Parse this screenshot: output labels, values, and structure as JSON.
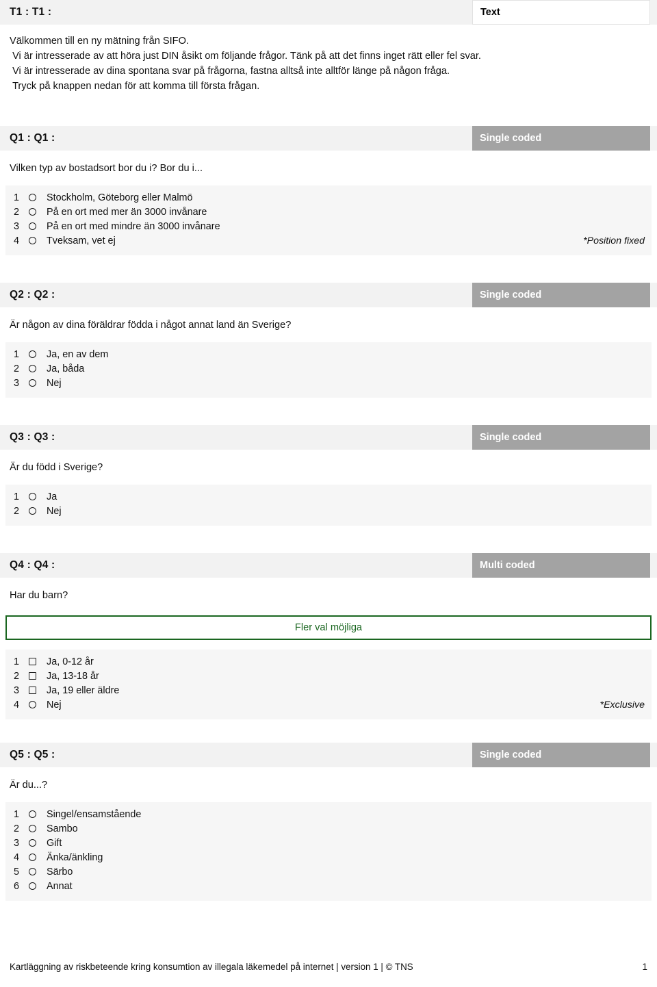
{
  "intro_section": {
    "title": "T1 : T1 :",
    "type_badge": "Text",
    "body_lines": [
      "Välkommen till en ny mätning från SIFO.",
      " Vi är intresserade av att höra just DIN åsikt om följande frågor. Tänk på att det finns inget rätt eller fel svar.",
      " Vi är intresserade av dina spontana svar på frågorna, fastna alltså inte alltför länge på någon fråga.",
      " Tryck på knappen nedan för att komma till första frågan."
    ]
  },
  "questions": [
    {
      "title": "Q1 : Q1 :",
      "type_badge": "Single coded",
      "text": "Vilken typ av bostadsort bor du i? Bor du i...",
      "note": "*Position fixed",
      "options": [
        {
          "num": "1",
          "mark": "radio-icon",
          "label": "Stockholm, Göteborg eller Malmö"
        },
        {
          "num": "2",
          "mark": "radio-icon",
          "label": "På en ort med mer än 3000 invånare"
        },
        {
          "num": "3",
          "mark": "radio-icon",
          "label": "På en ort med mindre än 3000 invånare"
        },
        {
          "num": "4",
          "mark": "radio-icon",
          "label": "Tveksam, vet ej"
        }
      ]
    },
    {
      "title": "Q2 : Q2 :",
      "type_badge": "Single coded",
      "text": "Är någon av dina föräldrar födda i något annat land än Sverige?",
      "note": "",
      "options": [
        {
          "num": "1",
          "mark": "radio-icon",
          "label": "Ja, en av dem"
        },
        {
          "num": "2",
          "mark": "radio-icon",
          "label": "Ja, båda"
        },
        {
          "num": "3",
          "mark": "radio-icon",
          "label": "Nej"
        }
      ]
    },
    {
      "title": "Q3 : Q3 :",
      "type_badge": "Single coded",
      "text": "Är du född i Sverige?",
      "note": "",
      "options": [
        {
          "num": "1",
          "mark": "radio-icon",
          "label": "Ja"
        },
        {
          "num": "2",
          "mark": "radio-icon",
          "label": "Nej"
        }
      ]
    },
    {
      "title": "Q4 : Q4 :",
      "type_badge": "Multi coded",
      "text": "Har du barn?",
      "hint_box": "Fler val möjliga",
      "note": "*Exclusive",
      "options": [
        {
          "num": "1",
          "mark": "checkbox-icon",
          "label": "Ja, 0-12 år"
        },
        {
          "num": "2",
          "mark": "checkbox-icon",
          "label": "Ja, 13-18 år"
        },
        {
          "num": "3",
          "mark": "checkbox-icon",
          "label": "Ja, 19 eller äldre"
        },
        {
          "num": "4",
          "mark": "radio-icon",
          "label": "Nej"
        }
      ]
    },
    {
      "title": "Q5 : Q5 :",
      "type_badge": "Single coded",
      "text": "Är du...?",
      "note": "",
      "options": [
        {
          "num": "1",
          "mark": "radio-icon",
          "label": "Singel/ensamstående"
        },
        {
          "num": "2",
          "mark": "radio-icon",
          "label": "Sambo"
        },
        {
          "num": "3",
          "mark": "radio-icon",
          "label": "Gift"
        },
        {
          "num": "4",
          "mark": "radio-icon",
          "label": "Änka/änkling"
        },
        {
          "num": "5",
          "mark": "radio-icon",
          "label": "Särbo"
        },
        {
          "num": "6",
          "mark": "radio-icon",
          "label": "Annat"
        }
      ]
    }
  ],
  "footer": {
    "text": "Kartläggning av riskbeteende kring konsumtion av illegala läkemedel på internet | version 1 | © TNS",
    "page_number": "1"
  },
  "colors": {
    "bar_bg": "#f2f2f2",
    "badge_gray": "#a3a3a3",
    "options_bg": "#f6f6f6",
    "hint_green": "#1a6620"
  }
}
